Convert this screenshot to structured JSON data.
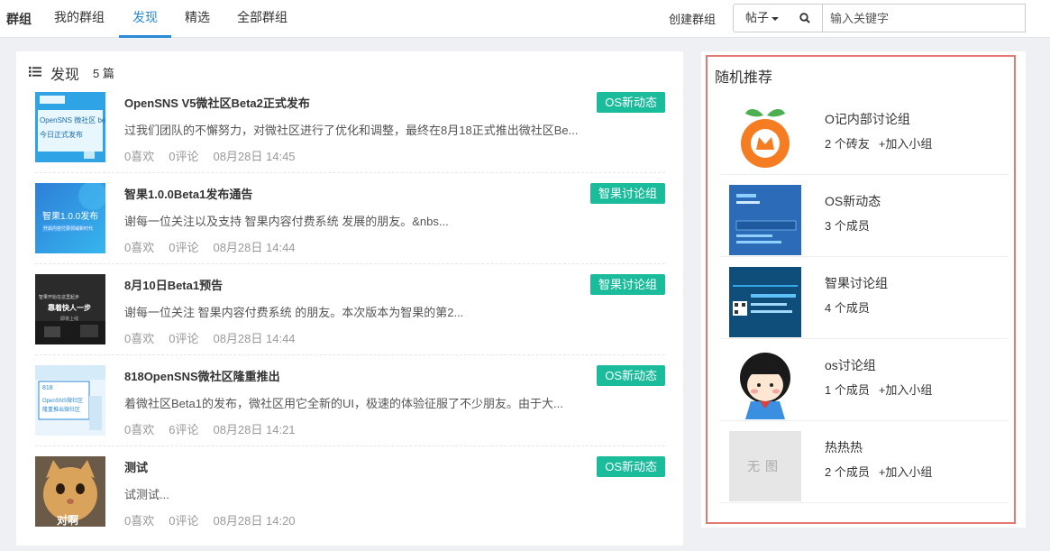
{
  "nav": {
    "brand": "群组",
    "items": [
      {
        "label": "我的群组"
      },
      {
        "label": "发现"
      },
      {
        "label": "精选"
      },
      {
        "label": "全部群组"
      }
    ],
    "create_label": "创建群组",
    "type_select": "帖子",
    "search_placeholder": "输入关键字"
  },
  "feed": {
    "title": "发现",
    "count": "5 篇",
    "posts": [
      {
        "title": "OpenSNS V5微社区Beta2正式发布",
        "summary": "过我们团队的不懈努力，对微社区进行了优化和调整，最终在8月18正式推出微社区Be...",
        "likes": "0喜欢",
        "comments": "0评论",
        "time": "08月28日 14:45",
        "tag": "OS新动态",
        "thumb_lines": [
          "OpenSNS 微社区 beta2",
          "今日正式发布"
        ]
      },
      {
        "title": "智果1.0.0Beta1发布通告",
        "summary": "谢每一位关注以及支持 智果内容付费系统 发展的朋友。&nbs...",
        "likes": "0喜欢",
        "comments": "0评论",
        "time": "08月28日 14:44",
        "tag": "智果讨论组",
        "thumb_lines": [
          "智果1.0.0发布",
          "开启内容付费领域新时代"
        ]
      },
      {
        "title": "8月10日Beta1预告",
        "summary": "谢每一位关注 智果内容付费系统 的朋友。本次版本为智果的第2...",
        "likes": "0喜欢",
        "comments": "0评论",
        "time": "08月28日 14:44",
        "tag": "智果讨论组",
        "thumb_lines": [
          "智果开始在这里起步",
          "靠着快人一步",
          "即将上线"
        ]
      },
      {
        "title": "818OpenSNS微社区隆重推出",
        "summary": "着微社区Beta1的发布，微社区用它全新的UI，极速的体验征服了不少朋友。由于大...",
        "likes": "0喜欢",
        "comments": "6评论",
        "time": "08月28日 14:21",
        "tag": "OS新动态",
        "thumb_lines": [
          "818",
          "OpenSNS微社区",
          "隆重推出微社区"
        ]
      },
      {
        "title": "测试",
        "summary": "试测试...",
        "likes": "0喜欢",
        "comments": "0评论",
        "time": "08月28日 14:20",
        "tag": "OS新动态",
        "thumb_lines": [
          "对啊"
        ]
      }
    ]
  },
  "recommend": {
    "title": "随机推荐",
    "join_label": "+加入小组",
    "no_image_label": "无图",
    "groups": [
      {
        "name": "O记内部讨论组",
        "meta": "2 个砖友",
        "joinable": true
      },
      {
        "name": "OS新动态",
        "meta": "3 个成员",
        "joinable": false
      },
      {
        "name": "智果讨论组",
        "meta": "4 个成员",
        "joinable": false
      },
      {
        "name": "os讨论组",
        "meta": "1 个成员",
        "joinable": true
      },
      {
        "name": "热热热",
        "meta": "2 个成员",
        "joinable": true
      }
    ]
  },
  "colors": {
    "accent": "#2a8ad6",
    "tag": "#1abc9c",
    "highlight_border": "#e07a72"
  }
}
